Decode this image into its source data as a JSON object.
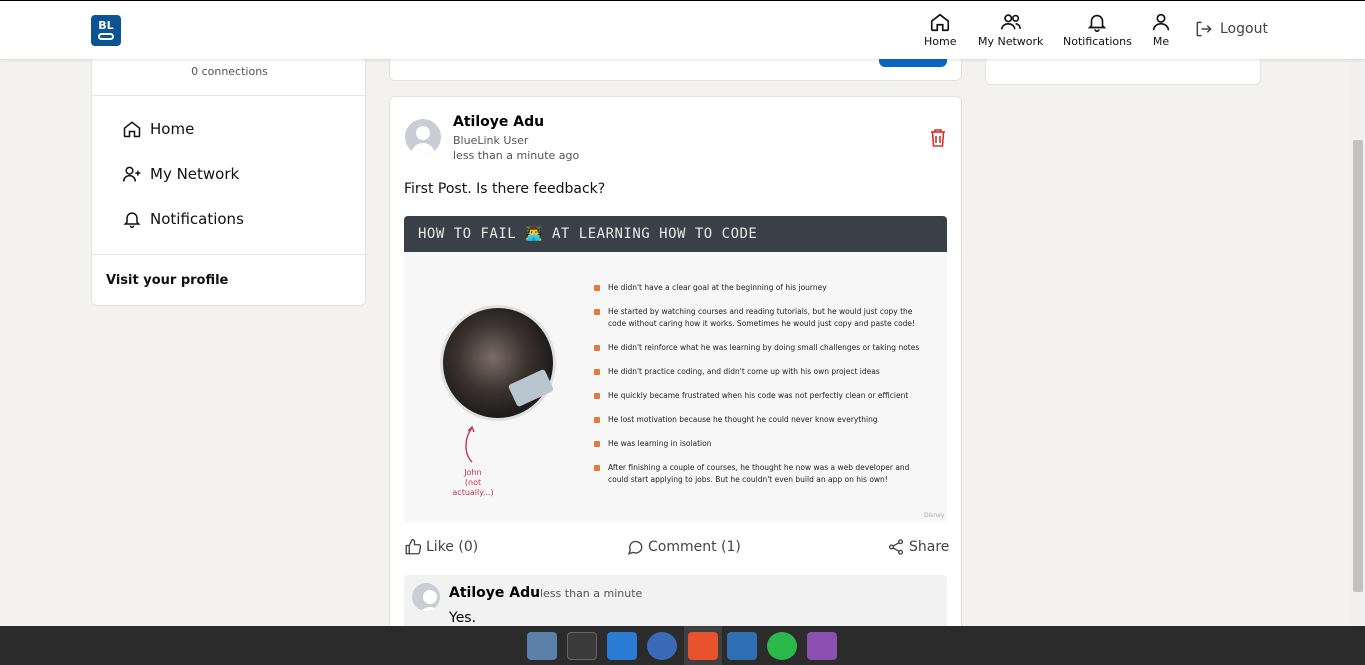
{
  "navbar": {
    "logo_text": "BL",
    "items": [
      {
        "label": "Home",
        "icon": "home-icon"
      },
      {
        "label": "My Network",
        "icon": "network-icon"
      },
      {
        "label": "Notifications",
        "icon": "bell-icon"
      },
      {
        "label": "Me",
        "icon": "user-icon"
      }
    ],
    "logout_label": "Logout"
  },
  "sidebar": {
    "connections": "0 connections",
    "items": [
      {
        "label": "Home",
        "icon": "home-icon"
      },
      {
        "label": "My Network",
        "icon": "add-user-icon"
      },
      {
        "label": "Notifications",
        "icon": "bell-icon"
      }
    ],
    "visit_profile": "Visit your profile"
  },
  "post": {
    "author": "Atiloye Adu",
    "role": "BlueLink User",
    "time": "less than a minute ago",
    "text": "First Post. Is there feedback?",
    "image": {
      "title": "HOW TO FAIL 👨‍💻 AT LEARNING HOW TO CODE",
      "caption_name": "John",
      "caption_note": "(not actually...)",
      "bullets": [
        "He didn't have a clear goal at the beginning of his journey",
        "He started by watching courses and reading tutorials, but he would just copy the code without caring how it works. Sometimes he would just copy and paste code!",
        "He didn't reinforce what he was learning by doing small challenges or taking notes",
        "He didn't practice coding, and didn't come up with his own project ideas",
        "He quickly became frustrated when his code was not perfectly clean or efficient",
        "He lost motivation because he thought he could never know everything",
        "He was learning in isolation",
        "After finishing a couple of courses, he thought he now was a web developer and could start applying to jobs. But he couldn't even build an app on his own!"
      ],
      "watermark": "Disney"
    },
    "actions": {
      "like": "Like (0)",
      "comment": "Comment (1)",
      "share": "Share"
    },
    "comment": {
      "author": "Atiloye Adu",
      "time": "less than a minute",
      "text": "Yes."
    }
  },
  "colors": {
    "brand": "#0b5394",
    "delete": "#d93025",
    "taskbar": "#2b2b2b"
  },
  "taskbar": {
    "apps": [
      "files-icon",
      "terminal-icon",
      "vscode-icon",
      "thunderbird-icon",
      "brave-icon",
      "writer-icon",
      "whatsapp-icon",
      "media-player-icon"
    ]
  }
}
